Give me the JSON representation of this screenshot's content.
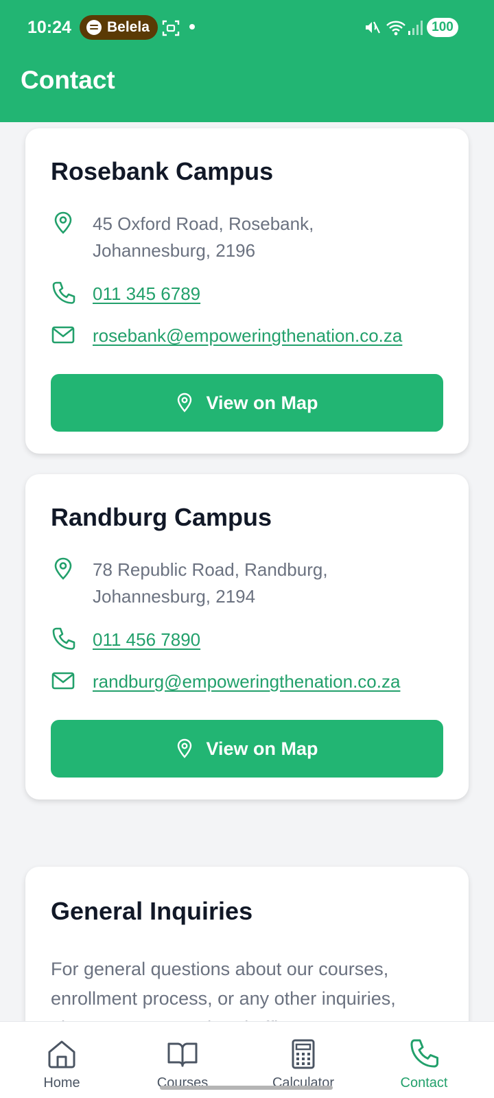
{
  "status_bar": {
    "time": "10:24",
    "media_app": "Belela",
    "battery": "100"
  },
  "header": {
    "title": "Contact"
  },
  "campuses": [
    {
      "name": "Rosebank Campus",
      "address_line1": "45 Oxford Road, Rosebank,",
      "address_line2": "Johannesburg, 2196",
      "phone": "011 345 6789",
      "email": "rosebank@empoweringthenation.co.za",
      "map_button": "View on Map"
    },
    {
      "name": "Randburg Campus",
      "address_line1": "78 Republic Road, Randburg,",
      "address_line2": "Johannesburg, 2194",
      "phone": "011 456 7890",
      "email": "randburg@empoweringthenation.co.za",
      "map_button": "View on Map"
    }
  ],
  "general": {
    "title": "General Inquiries",
    "line1": "For general questions about our courses,",
    "line2": "enrollment process, or any other inquiries,",
    "line3": "please contact our head office:"
  },
  "nav": {
    "items": [
      {
        "label": "Home",
        "icon": "home-icon"
      },
      {
        "label": "Courses",
        "icon": "book-icon"
      },
      {
        "label": "Calculator",
        "icon": "calculator-icon"
      },
      {
        "label": "Contact",
        "icon": "phone-icon",
        "active": true
      }
    ]
  },
  "colors": {
    "brand": "#22b573",
    "link": "#22a06b",
    "background": "#f3f4f6"
  }
}
